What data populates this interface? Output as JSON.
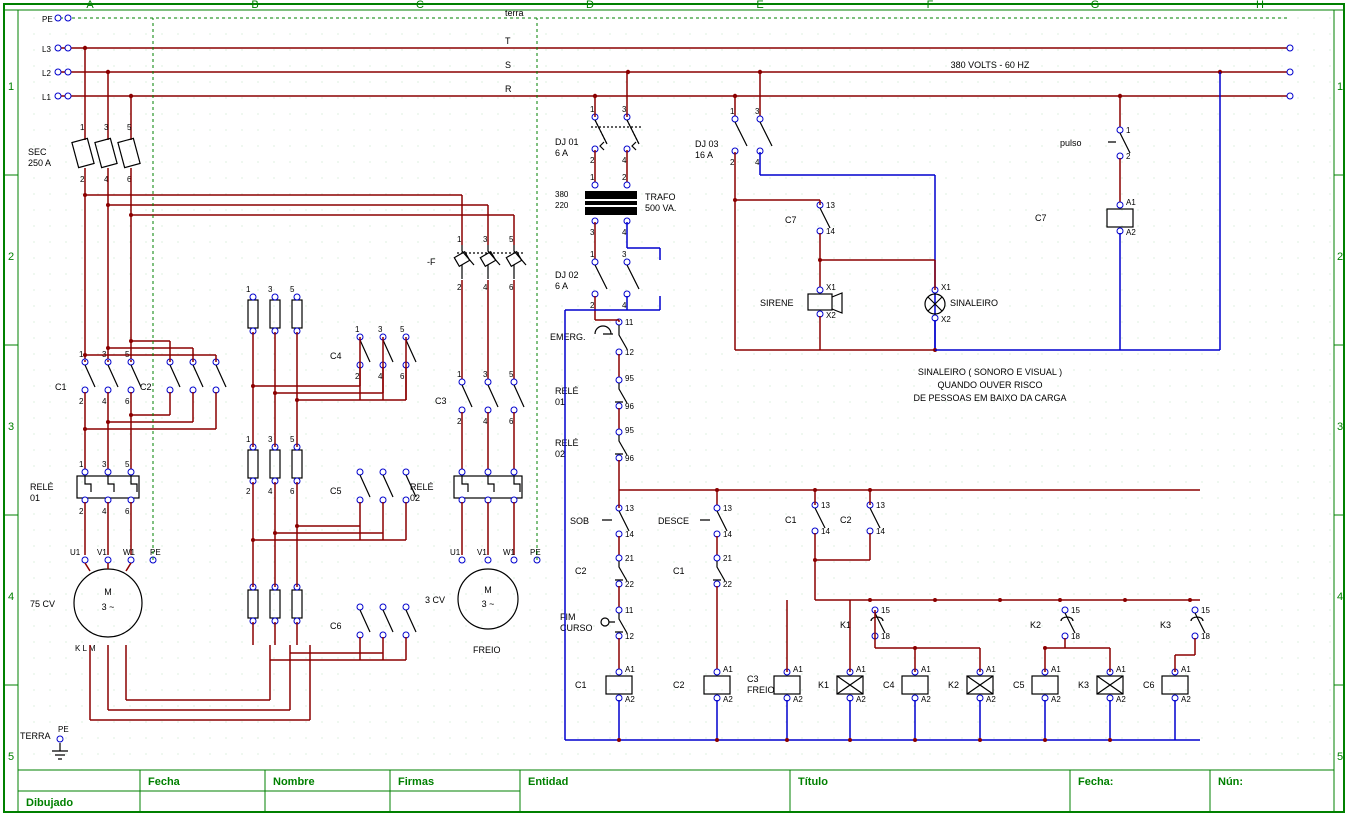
{
  "frame": {
    "cols": [
      "A",
      "B",
      "C",
      "D",
      "E",
      "F",
      "G",
      "H"
    ],
    "rows": [
      "1",
      "2",
      "3",
      "4",
      "5"
    ]
  },
  "titleblock": {
    "fecha": "Fecha",
    "nombre": "Nombre",
    "firmas": "Firmas",
    "entidad": "Entidad",
    "titulo": "Título",
    "fecha2": "Fecha:",
    "num": "Nún:",
    "dibujado": "Dibujado"
  },
  "bus": {
    "terra": "terra",
    "T": "T",
    "S": "S",
    "R": "R",
    "volts": "380 VOLTS - 60 HZ",
    "PE": "PE",
    "L3": "L3",
    "L2": "L2",
    "L1": "L1",
    "TERRA": "TERRA"
  },
  "comp": {
    "sec": "SEC\n250 A",
    "dj01": "DJ 01\n6 A",
    "dj02": "DJ 02\n6 A",
    "dj03": "DJ 03\n16 A",
    "pulso": "pulso",
    "trafo": "TRAFO\n500 VA.",
    "trafo_v": "380\n220",
    "F": "-F",
    "C1": "C1",
    "C2": "C2",
    "C3": "C3",
    "C4": "C4",
    "C5": "C5",
    "C6": "C6",
    "C7": "C7",
    "K1": "K1",
    "K2": "K2",
    "K3": "K3",
    "rele01": "RELÉ\n01",
    "rele02": "RELÉ\n02",
    "rele_01": "RELÉ\n01",
    "rele_02": "RELÉ\n02",
    "emerg": "EMERG.",
    "sob": "SOB",
    "desce": "DESCE",
    "fimcurso": "FIM\nCURSO",
    "sirene": "SIRENE",
    "sinaleiro": "SINALEIRO",
    "c3freio": "C3\nFREIO",
    "motor1": "75 CV",
    "motor2": "3 CV",
    "M": "M",
    "3ph": "3 ~",
    "freio": "FREIO",
    "KLM": "K    L    M",
    "A1": "A1",
    "A2": "A2",
    "X1": "X1",
    "X2": "X2",
    "U1": "U1",
    "V1": "V1",
    "W1": "W1",
    "PEs": "PE"
  },
  "note": {
    "l1": "SINALEIRO ( SONORO E VISUAL )",
    "l2": "QUANDO OUVER RISCO",
    "l3": "DE PESSOAS EM BAIXO DA CARGA"
  },
  "terms": {
    "t1": "1",
    "t2": "2",
    "t3": "3",
    "t4": "4",
    "t5": "5",
    "t6": "6",
    "t11": "11",
    "t12": "12",
    "t13": "13",
    "t14": "14",
    "t15": "15",
    "t18": "18",
    "t21": "21",
    "t22": "22",
    "t95": "95",
    "t96": "96"
  }
}
